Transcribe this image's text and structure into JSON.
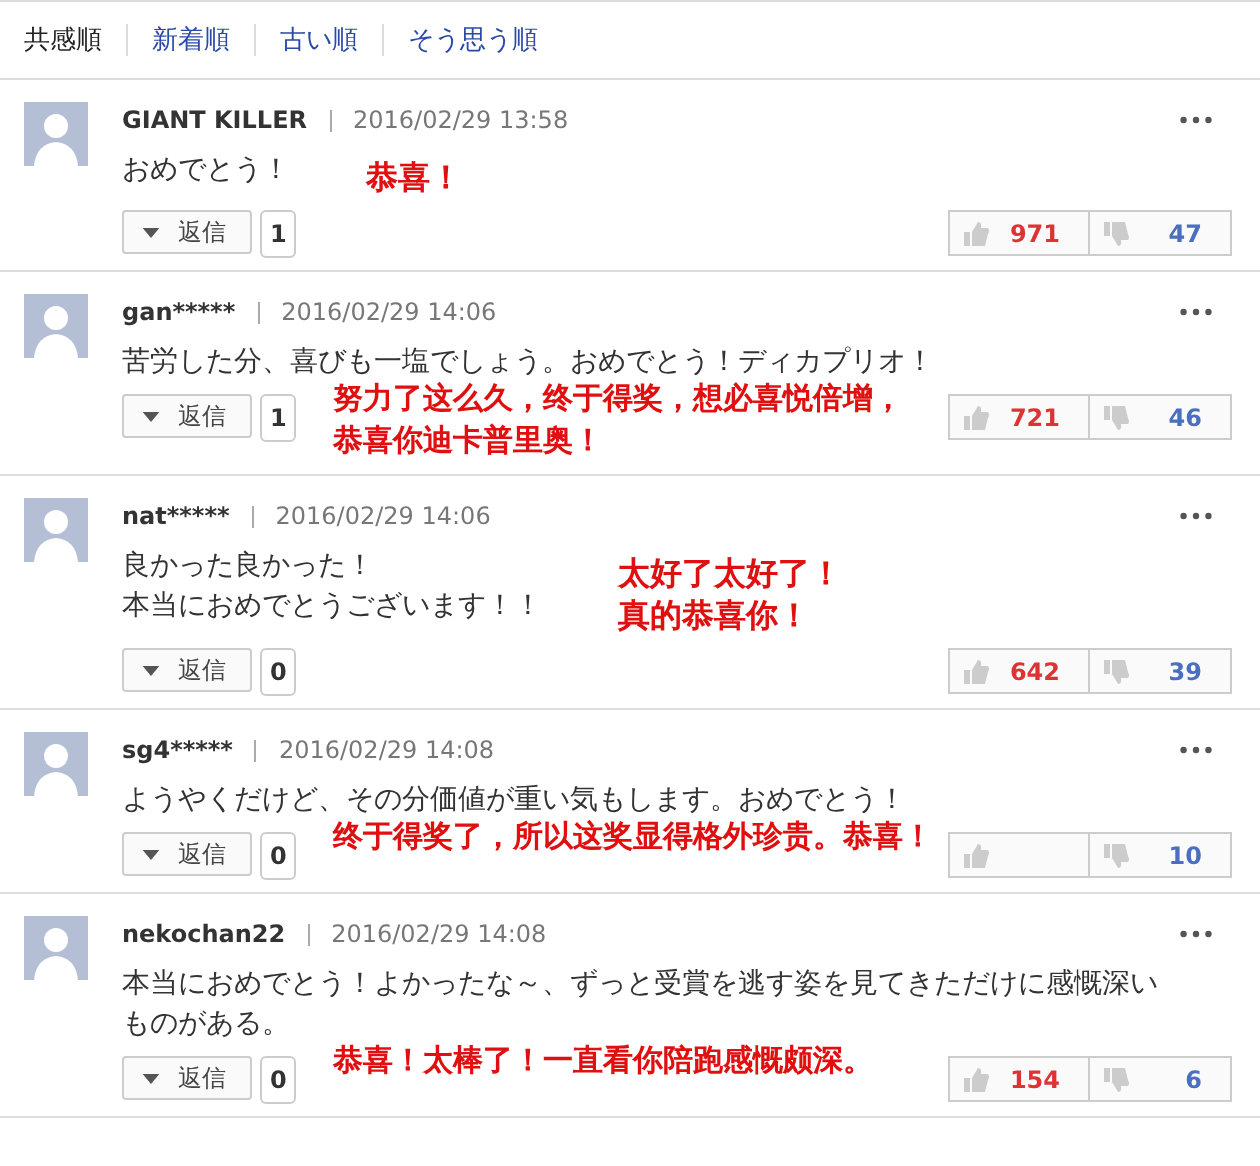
{
  "sort_tabs": [
    {
      "label": "共感順",
      "selected": true
    },
    {
      "label": "新着順",
      "selected": false
    },
    {
      "label": "古い順",
      "selected": false
    },
    {
      "label": "そう思う順",
      "selected": false
    }
  ],
  "comments": [
    {
      "user": "GIANT KILLER",
      "date": "2016/02/29 13:58",
      "lines": [
        "おめでとう！"
      ],
      "reply_label": "返信",
      "reply_count": "1",
      "likes": "971",
      "dislikes": "47",
      "annotation": {
        "kind": "inline",
        "lines": [
          "恭喜！"
        ]
      }
    },
    {
      "user": "gan*****",
      "date": "2016/02/29 14:06",
      "lines": [
        "苦労した分、喜びも一塩でしょう。おめでとう！ディカプリオ！"
      ],
      "reply_label": "返信",
      "reply_count": "1",
      "likes": "721",
      "dislikes": "46",
      "annotation": {
        "kind": "actions",
        "lines": [
          "努力了这么久，终于得奖，想必喜悦倍增，",
          "恭喜你迪卡普里奥！"
        ]
      }
    },
    {
      "user": "nat*****",
      "date": "2016/02/29 14:06",
      "lines": [
        "良かった良かった！",
        "本当におめでとうございます！！"
      ],
      "reply_label": "返信",
      "reply_count": "0",
      "likes": "642",
      "dislikes": "39",
      "annotation": {
        "kind": "inline",
        "lines": [
          "太好了太好了！",
          "真的恭喜你！"
        ]
      }
    },
    {
      "user": "sg4*****",
      "date": "2016/02/29 14:08",
      "lines": [
        "ようやくだけど、その分価値が重い気もします。おめでとう！"
      ],
      "reply_label": "返信",
      "reply_count": "0",
      "dislikes": "10",
      "annotation": {
        "kind": "actions",
        "lines": [
          "终于得奖了，所以这奖显得格外珍贵。恭喜！"
        ]
      }
    },
    {
      "user": "nekochan22",
      "date": "2016/02/29 14:08",
      "lines": [
        "本当におめでとう！よかったな～、ずっと受賞を逃す姿を見てきただけに感慨深いものがある。"
      ],
      "reply_label": "返信",
      "reply_count": "0",
      "likes": "154",
      "dislikes": "6",
      "annotation": {
        "kind": "actions",
        "lines": [
          "恭喜！太棒了！一直看你陪跑感慨颇深。"
        ]
      }
    }
  ]
}
